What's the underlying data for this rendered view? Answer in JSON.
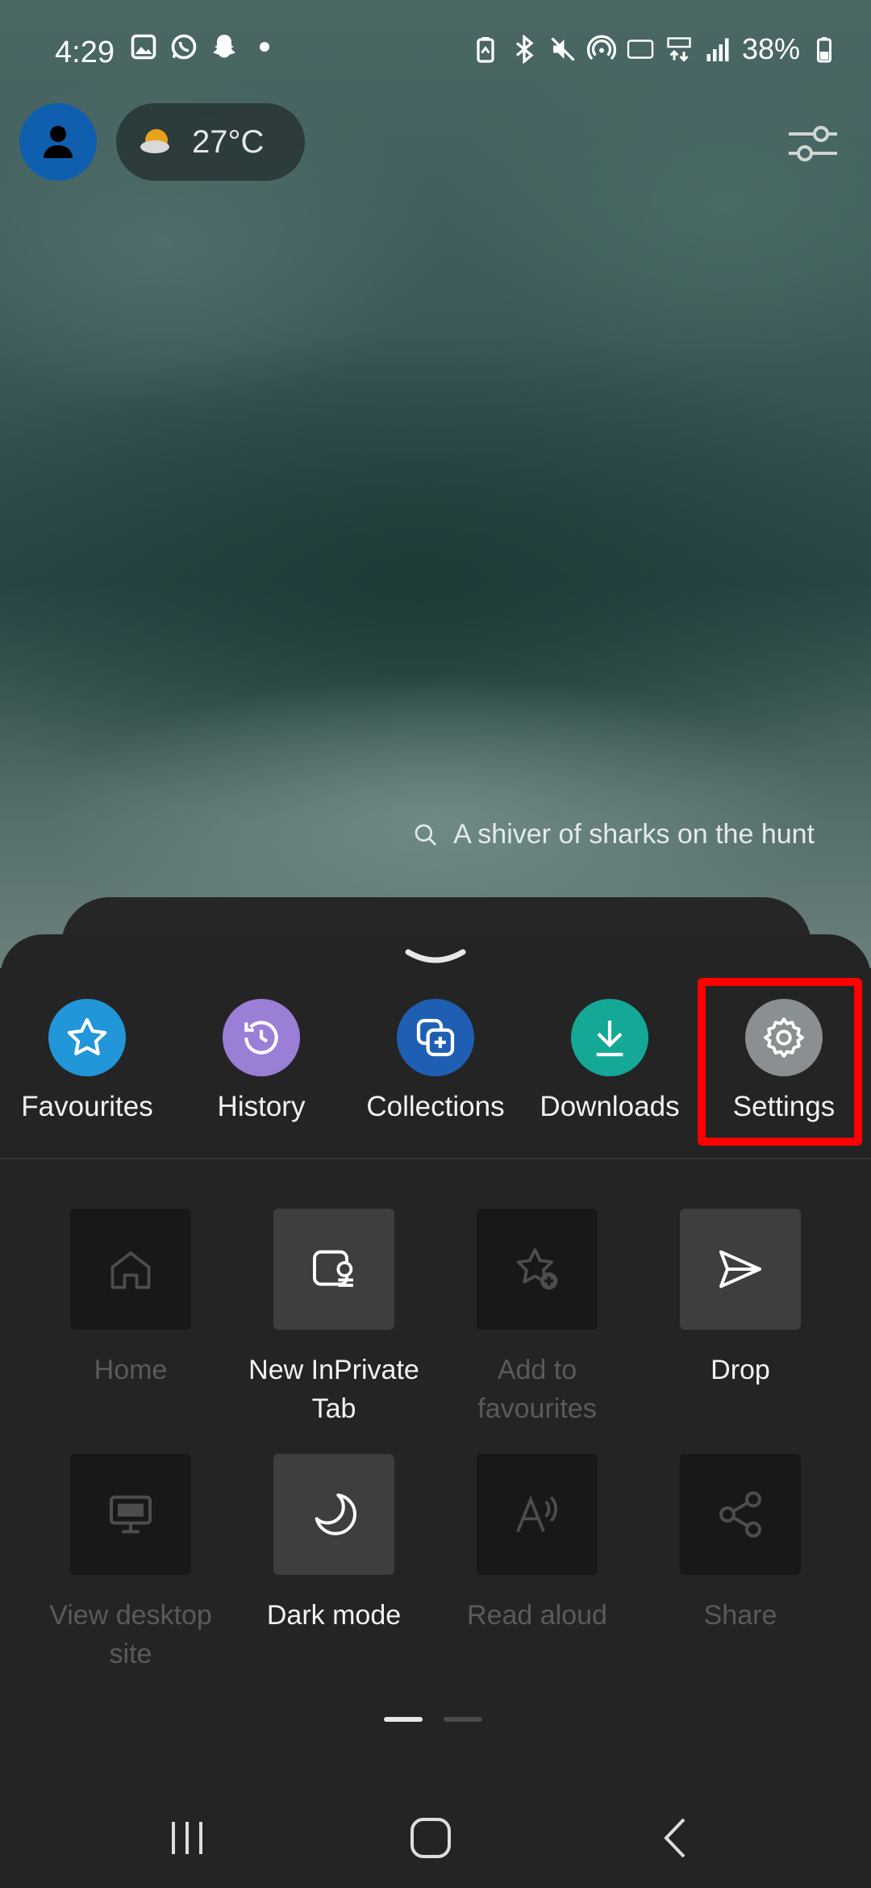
{
  "status_bar": {
    "time": "4:29",
    "battery": "38%"
  },
  "top": {
    "temperature": "27°C"
  },
  "search_hint": "A shiver of sharks on the hunt",
  "quick_actions": [
    {
      "label": "Favourites",
      "icon": "star-icon",
      "color": "#2196d8"
    },
    {
      "label": "History",
      "icon": "history-icon",
      "color": "#9b7ed6"
    },
    {
      "label": "Collections",
      "icon": "collections-icon",
      "color": "#1e5fb4"
    },
    {
      "label": "Downloads",
      "icon": "download-icon",
      "color": "#14a896"
    },
    {
      "label": "Settings",
      "icon": "gear-icon",
      "color": "#8a8f91"
    }
  ],
  "menu_items": [
    {
      "label": "Home",
      "enabled": false,
      "icon": "home-icon"
    },
    {
      "label": "New InPrivate Tab",
      "enabled": true,
      "icon": "inprivate-tab-icon"
    },
    {
      "label": "Add to favourites",
      "enabled": false,
      "icon": "add-favourite-icon"
    },
    {
      "label": "Drop",
      "enabled": true,
      "icon": "send-icon"
    },
    {
      "label": "View desktop site",
      "enabled": false,
      "icon": "desktop-icon"
    },
    {
      "label": "Dark mode",
      "enabled": true,
      "icon": "moon-icon"
    },
    {
      "label": "Read aloud",
      "enabled": false,
      "icon": "read-aloud-icon"
    },
    {
      "label": "Share",
      "enabled": false,
      "icon": "share-icon"
    }
  ],
  "page_indicator": {
    "pages": 2,
    "current": 1
  },
  "highlight_color": "#ff0000"
}
